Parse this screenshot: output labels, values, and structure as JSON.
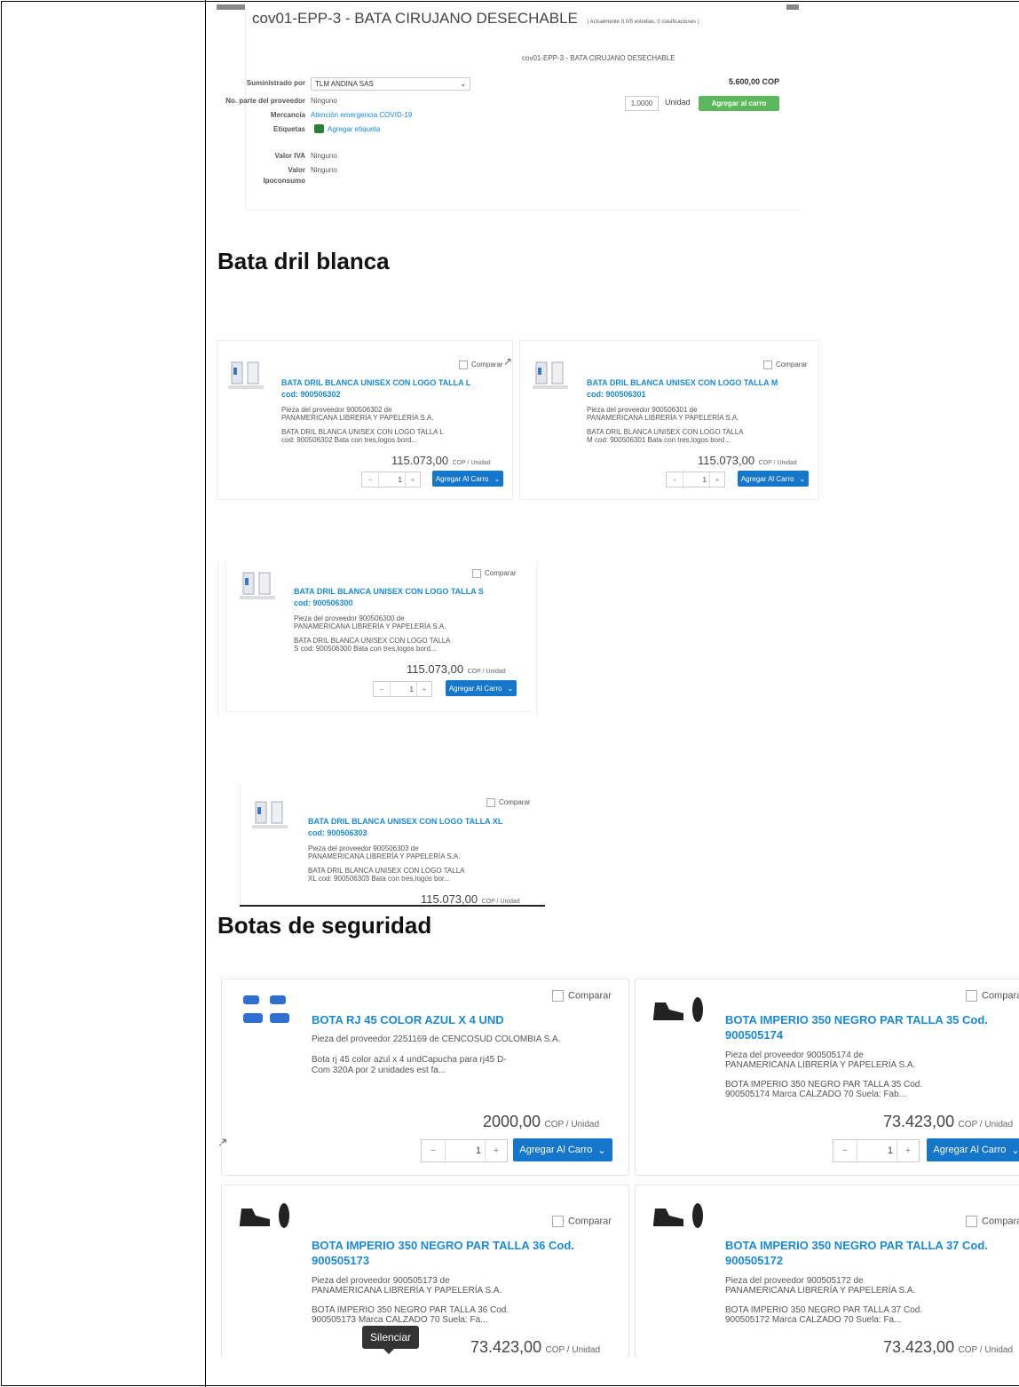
{
  "top_panel": {
    "title": "cov01-EPP-3 - BATA CIRUJANO DESECHABLE",
    "rating": "( Actualmente 0.0/5 estrellas. 0 clasificaciones )",
    "subtitle": "cov01-EPP-3 - BATA CIRUJANO DESECHABLE",
    "supplied_label": "Suministrado por",
    "supplier_value": "TLM ANDINA SAS",
    "part_label": "No. parte del proveedor",
    "part_value": "Ninguno",
    "goods_label": "Mercancía",
    "goods_value": "Atención emergencia COVID-19",
    "tags_label": "Etiquetas",
    "tags_value": "Agregar etiqueta",
    "iva_label": "Valor IVA",
    "iva_value": "Ninguno",
    "ipo_label_1": "Valor",
    "ipo_label_2": "Ipoconsumo",
    "ipo_value": "Ninguno",
    "price": "5.600,00 COP",
    "qty": "1,0000",
    "unit": "Unidad",
    "add_button": "Agregar al carro"
  },
  "sections": {
    "bata": "Bata dril blanca",
    "botas": "Botas de seguridad"
  },
  "common": {
    "compare": "Comparar",
    "qty": "1",
    "add": "Agregar Al Carro",
    "unit": "COP / Unidad",
    "minus": "−",
    "plus": "+"
  },
  "bata_products": [
    {
      "title": "BATA DRIL BLANCA UNISEX CON LOGO TALLA L",
      "code": "cod: 900506302",
      "supplier_1": "Pieza del proveedor 900506302 de",
      "supplier_2": "PANAMERICANA LIBRERÍA Y PAPELERÍA S.A.",
      "desc_1": "BATA DRIL BLANCA UNISEX CON LOGO TALLA L",
      "desc_2": "cod: 900506302 Bata con tres,logos bord...",
      "price": "115.073,00"
    },
    {
      "title": "BATA DRIL BLANCA UNISEX CON LOGO TALLA M",
      "code": "cod: 900506301",
      "supplier_1": "Pieza del proveedor 900506301 de",
      "supplier_2": "PANAMERICANA LIBRERÍA Y PAPELERÍA S.A.",
      "desc_1": "BATA DRIL BLANCA UNISEX CON LOGO TALLA",
      "desc_2": "M cod: 900506301 Bata con tres,logos bord...",
      "price": "115.073,00"
    },
    {
      "title": "BATA DRIL BLANCA UNISEX CON LOGO TALLA S",
      "code": "cod: 900506300",
      "supplier_1": "Pieza del proveedor 900506300 de",
      "supplier_2": "PANAMERICANA LIBRERÍA Y PAPELERÍA S.A.",
      "desc_1": "BATA DRIL BLANCA UNISEX CON LOGO TALLA",
      "desc_2": "S cod: 900506300 Bata con tres,logos bord...",
      "price": "115.073,00"
    },
    {
      "title": "BATA DRIL BLANCA UNISEX CON LOGO TALLA XL",
      "code": "cod: 900506303",
      "supplier_1": "Pieza del proveedor 900506303 de",
      "supplier_2": "PANAMERICANA LIBRERÍA Y PAPELERÍA S.A.",
      "desc_1": "BATA DRIL BLANCA UNISEX CON LOGO TALLA",
      "desc_2": "XL cod: 900506303 Bata con tres,logos bor...",
      "price": "115.073,00"
    }
  ],
  "botas_products": [
    {
      "title_1": "BOTA RJ 45 COLOR AZUL X 4 UND",
      "title_2": "",
      "supplier_1": "Pieza del proveedor 2251169 de CENCOSUD COLOMBIA S.A.",
      "supplier_2": "",
      "desc_1": "Bota rj 45 color azul x 4 undCapucha para rj45 D-",
      "desc_2": "Com 320A por 2 unidades est fa...",
      "price": "2000,00"
    },
    {
      "title_1": "BOTA IMPERIO 350 NEGRO PAR TALLA 35 Cod.",
      "title_2": "900505174",
      "supplier_1": "Pieza del proveedor 900505174 de",
      "supplier_2": "PANAMERICANA LIBRERÍA Y PAPELERÍA S.A.",
      "desc_1": "BOTA IMPERIO 350 NEGRO PAR TALLA 35 Cod.",
      "desc_2": "900505174 Marca CALZADO 70 Suela: Fab...",
      "price": "73.423,00"
    },
    {
      "title_1": "BOTA IMPERIO 350 NEGRO PAR TALLA 36 Cod.",
      "title_2": "900505173",
      "supplier_1": "Pieza del proveedor 900505173 de",
      "supplier_2": "PANAMERICANA LIBRERÍA Y PAPELERÍA S.A.",
      "desc_1": "BOTA IMPERIO 350 NEGRO PAR TALLA 36 Cod.",
      "desc_2": "900505173 Marca CALZADO 70 Suela: Fa...",
      "price": "73.423,00"
    },
    {
      "title_1": "BOTA IMPERIO 350 NEGRO PAR TALLA 37 Cod.",
      "title_2": "900505172",
      "supplier_1": "Pieza del proveedor 900505172 de",
      "supplier_2": "PANAMERICANA LIBRERÍA Y PAPELERÍA S.A.",
      "desc_1": "BOTA IMPERIO 350 NEGRO PAR TALLA 37 Cod.",
      "desc_2": "900505172 Marca CALZADO 70 Suela: Fa...",
      "price": "73.423,00"
    }
  ],
  "tooltip": "Silenciar",
  "colors": {
    "link": "#1a8ad4",
    "button_blue": "#1676c9",
    "button_green": "#5cb85c"
  }
}
